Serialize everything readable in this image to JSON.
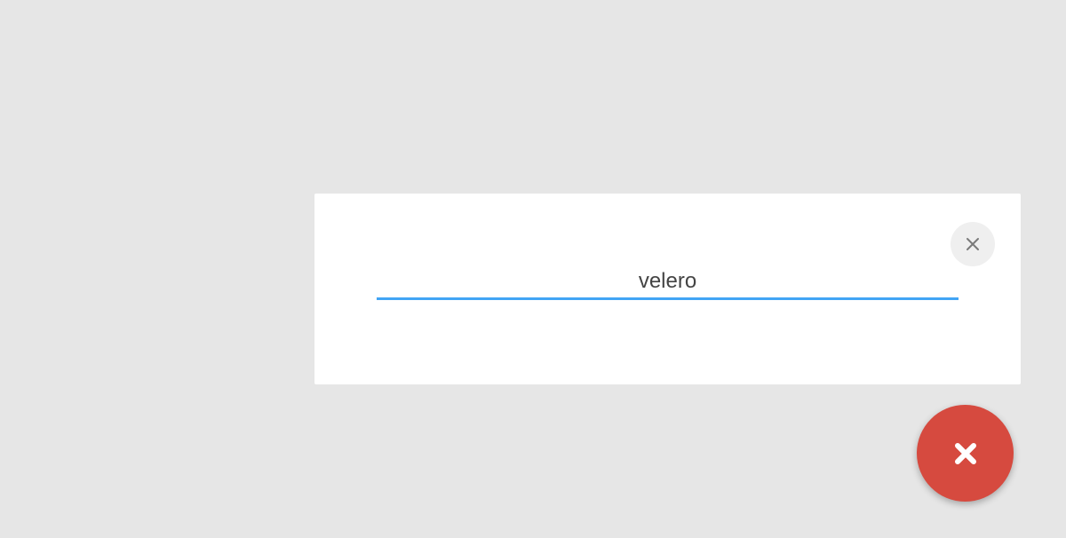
{
  "search": {
    "value": "velero"
  },
  "icons": {
    "panel_close": "close-icon",
    "fab": "close-icon"
  },
  "colors": {
    "background": "#e6e6e6",
    "panel": "#ffffff",
    "input_underline": "#42a5f5",
    "fab": "#d64a3f",
    "panel_close_bg": "#efefef"
  }
}
